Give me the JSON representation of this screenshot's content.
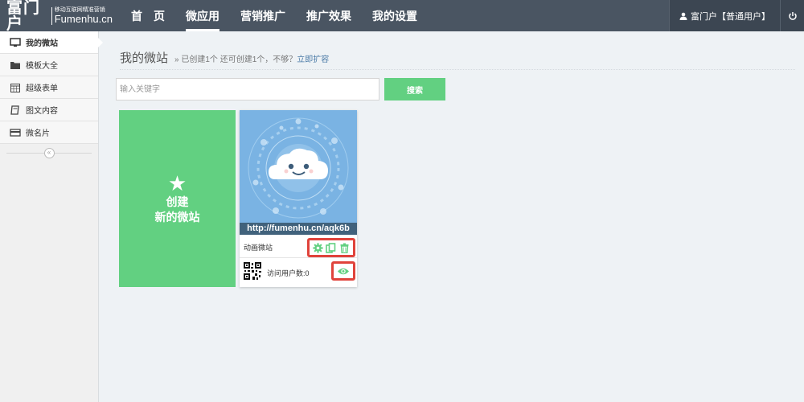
{
  "header": {
    "logo_big": "富门户",
    "logo_tagline": "移动互联网精准营销",
    "logo_domain": "Fumenhu.cn",
    "nav": [
      {
        "label": "首　页"
      },
      {
        "label": "微应用",
        "active": true
      },
      {
        "label": "营销推广"
      },
      {
        "label": "推广效果"
      },
      {
        "label": "我的设置"
      }
    ],
    "user_label": "富门户【普通用户】"
  },
  "sidebar": {
    "items": [
      {
        "label": "我的微站",
        "icon": "monitor-icon",
        "active": true
      },
      {
        "label": "模板大全",
        "icon": "folder-icon"
      },
      {
        "label": "超级表单",
        "icon": "calendar-icon"
      },
      {
        "label": "图文内容",
        "icon": "book-icon"
      },
      {
        "label": "微名片",
        "icon": "card-icon"
      }
    ],
    "collapse_symbol": "«"
  },
  "main": {
    "title": "我的微站",
    "subtitle": "» 已创建1个 还可创建1个，不够？",
    "subtitle_link": "立即扩容",
    "search": {
      "placeholder": "输入关键字",
      "value": "",
      "button_label": "搜索"
    },
    "create_card": {
      "star": "★",
      "line1": "创建",
      "line2": "新的微站"
    },
    "site_card": {
      "url": "http://fumenhu.cn/aqk6b",
      "name": "动画微站",
      "visits_label": "访问用户数:0"
    }
  },
  "colors": {
    "topbar": "#4a5562",
    "accent_green": "#62d081",
    "highlight_red": "#e0433b"
  }
}
